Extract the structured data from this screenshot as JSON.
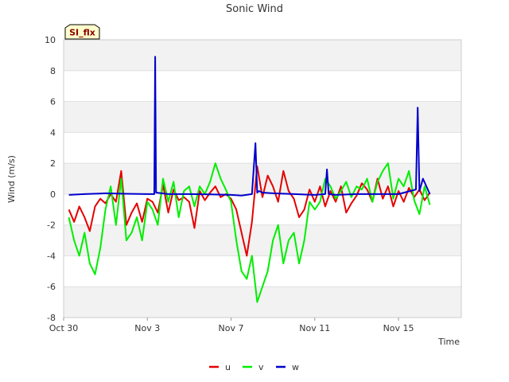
{
  "chart_data": {
    "type": "line",
    "title": "Sonic Wind",
    "xlabel": "Time",
    "ylabel": "Wind (m/s)",
    "badge": "SI_flx",
    "ylim": [
      -8,
      10
    ],
    "yticks": [
      -8,
      -6,
      -4,
      -2,
      0,
      2,
      4,
      6,
      8,
      10
    ],
    "xlim": [
      "2023-10-30",
      "2023-11-18"
    ],
    "xticks": [
      {
        "date": "2023-10-30",
        "label": "Oct 30"
      },
      {
        "date": "2023-11-03",
        "label": "Nov 3"
      },
      {
        "date": "2023-11-07",
        "label": "Nov 7"
      },
      {
        "date": "2023-11-11",
        "label": "Nov 11"
      },
      {
        "date": "2023-11-15",
        "label": "Nov 15"
      }
    ],
    "grid": true,
    "legend": "bottom",
    "series": [
      {
        "name": "u",
        "color": "#e60000",
        "x": [
          "2023-10-30 06:00",
          "2023-10-30 12:00",
          "2023-10-30 18:00",
          "2023-10-31 00:00",
          "2023-10-31 06:00",
          "2023-10-31 12:00",
          "2023-10-31 18:00",
          "2023-11-01 00:00",
          "2023-11-01 06:00",
          "2023-11-01 12:00",
          "2023-11-01 18:00",
          "2023-11-02 00:00",
          "2023-11-02 06:00",
          "2023-11-02 12:00",
          "2023-11-02 18:00",
          "2023-11-03 00:00",
          "2023-11-03 06:00",
          "2023-11-03 12:00",
          "2023-11-03 18:00",
          "2023-11-04 00:00",
          "2023-11-04 06:00",
          "2023-11-04 12:00",
          "2023-11-04 18:00",
          "2023-11-05 00:00",
          "2023-11-05 06:00",
          "2023-11-05 12:00",
          "2023-11-05 18:00",
          "2023-11-06 00:00",
          "2023-11-06 06:00",
          "2023-11-06 12:00",
          "2023-11-06 18:00",
          "2023-11-07 00:00",
          "2023-11-07 06:00",
          "2023-11-07 12:00",
          "2023-11-07 18:00",
          "2023-11-08 00:00",
          "2023-11-08 06:00",
          "2023-11-08 12:00",
          "2023-11-08 18:00",
          "2023-11-09 00:00",
          "2023-11-09 06:00",
          "2023-11-09 12:00",
          "2023-11-09 18:00",
          "2023-11-10 00:00",
          "2023-11-10 06:00",
          "2023-11-10 12:00",
          "2023-11-10 18:00",
          "2023-11-11 00:00",
          "2023-11-11 06:00",
          "2023-11-11 12:00",
          "2023-11-11 18:00",
          "2023-11-12 00:00",
          "2023-11-12 06:00",
          "2023-11-12 12:00",
          "2023-11-12 18:00",
          "2023-11-13 00:00",
          "2023-11-13 06:00",
          "2023-11-13 12:00",
          "2023-11-13 18:00",
          "2023-11-14 00:00",
          "2023-11-14 06:00",
          "2023-11-14 12:00",
          "2023-11-14 18:00",
          "2023-11-15 00:00",
          "2023-11-15 06:00",
          "2023-11-15 12:00",
          "2023-11-15 18:00",
          "2023-11-16 00:00",
          "2023-11-16 06:00",
          "2023-11-16 12:00"
        ],
        "y": [
          -1.0,
          -1.8,
          -0.8,
          -1.5,
          -2.4,
          -0.8,
          -0.3,
          -0.6,
          0.0,
          -0.5,
          1.5,
          -2.0,
          -1.2,
          -0.6,
          -1.8,
          -0.3,
          -0.5,
          -1.2,
          0.6,
          -1.2,
          0.3,
          -0.4,
          -0.2,
          -0.5,
          -2.2,
          0.2,
          -0.4,
          0.1,
          0.5,
          -0.2,
          0.0,
          -0.3,
          -1.0,
          -2.5,
          -4.0,
          -1.8,
          1.8,
          -0.2,
          1.2,
          0.5,
          -0.5,
          1.5,
          0.2,
          -0.3,
          -1.5,
          -1.0,
          0.3,
          -0.5,
          0.5,
          -0.8,
          0.2,
          -0.5,
          0.5,
          -1.2,
          -0.6,
          -0.1,
          0.7,
          0.3,
          -0.5,
          1.0,
          -0.3,
          0.5,
          -0.8,
          0.2,
          -0.5,
          0.4,
          -0.2,
          0.3,
          -0.4,
          0.1
        ]
      },
      {
        "name": "v",
        "color": "#00ee00",
        "x": [
          "2023-10-30 06:00",
          "2023-10-30 12:00",
          "2023-10-30 18:00",
          "2023-10-31 00:00",
          "2023-10-31 06:00",
          "2023-10-31 12:00",
          "2023-10-31 18:00",
          "2023-11-01 00:00",
          "2023-11-01 06:00",
          "2023-11-01 12:00",
          "2023-11-01 18:00",
          "2023-11-02 00:00",
          "2023-11-02 06:00",
          "2023-11-02 12:00",
          "2023-11-02 18:00",
          "2023-11-03 00:00",
          "2023-11-03 06:00",
          "2023-11-03 12:00",
          "2023-11-03 18:00",
          "2023-11-04 00:00",
          "2023-11-04 06:00",
          "2023-11-04 12:00",
          "2023-11-04 18:00",
          "2023-11-05 00:00",
          "2023-11-05 06:00",
          "2023-11-05 12:00",
          "2023-11-05 18:00",
          "2023-11-06 00:00",
          "2023-11-06 06:00",
          "2023-11-06 12:00",
          "2023-11-06 18:00",
          "2023-11-07 00:00",
          "2023-11-07 06:00",
          "2023-11-07 12:00",
          "2023-11-07 18:00",
          "2023-11-08 00:00",
          "2023-11-08 06:00",
          "2023-11-08 12:00",
          "2023-11-08 18:00",
          "2023-11-09 00:00",
          "2023-11-09 06:00",
          "2023-11-09 12:00",
          "2023-11-09 18:00",
          "2023-11-10 00:00",
          "2023-11-10 06:00",
          "2023-11-10 12:00",
          "2023-11-10 18:00",
          "2023-11-11 00:00",
          "2023-11-11 06:00",
          "2023-11-11 12:00",
          "2023-11-11 18:00",
          "2023-11-12 00:00",
          "2023-11-12 06:00",
          "2023-11-12 12:00",
          "2023-11-12 18:00",
          "2023-11-13 00:00",
          "2023-11-13 06:00",
          "2023-11-13 12:00",
          "2023-11-13 18:00",
          "2023-11-14 00:00",
          "2023-11-14 06:00",
          "2023-11-14 12:00",
          "2023-11-14 18:00",
          "2023-11-15 00:00",
          "2023-11-15 06:00",
          "2023-11-15 12:00",
          "2023-11-15 18:00",
          "2023-11-16 00:00",
          "2023-11-16 06:00",
          "2023-11-16 12:00"
        ],
        "y": [
          -1.5,
          -3.0,
          -4.0,
          -2.5,
          -4.5,
          -5.2,
          -3.5,
          -1.0,
          0.5,
          -2.0,
          1.0,
          -3.0,
          -2.5,
          -1.5,
          -3.0,
          -0.5,
          -1.0,
          -2.0,
          1.0,
          -0.5,
          0.8,
          -1.5,
          0.2,
          0.5,
          -0.8,
          0.5,
          0.0,
          0.8,
          2.0,
          1.0,
          0.3,
          -0.5,
          -3.0,
          -5.0,
          -5.5,
          -4.0,
          -7.0,
          -6.0,
          -5.0,
          -3.0,
          -2.0,
          -4.5,
          -3.0,
          -2.5,
          -4.5,
          -3.0,
          -0.5,
          -1.0,
          -0.5,
          1.0,
          0.5,
          -0.3,
          0.2,
          0.8,
          -0.2,
          0.5,
          0.3,
          1.0,
          -0.5,
          0.8,
          1.5,
          2.0,
          -0.3,
          1.0,
          0.5,
          1.5,
          -0.4,
          -1.3,
          0.5,
          -0.7
        ]
      },
      {
        "name": "w",
        "color": "#0000cc",
        "x": [
          "2023-10-30 06:00",
          "2023-10-31 00:00",
          "2023-11-01 00:00",
          "2023-11-02 00:00",
          "2023-11-03 00:00",
          "2023-11-03 08:00",
          "2023-11-03 09:00",
          "2023-11-03 10:00",
          "2023-11-04 00:00",
          "2023-11-05 00:00",
          "2023-11-06 00:00",
          "2023-11-07 00:00",
          "2023-11-07 12:00",
          "2023-11-08 00:00",
          "2023-11-08 04:00",
          "2023-11-08 06:00",
          "2023-11-08 08:00",
          "2023-11-08 12:00",
          "2023-11-09 00:00",
          "2023-11-10 00:00",
          "2023-11-11 00:00",
          "2023-11-11 12:00",
          "2023-11-11 14:00",
          "2023-11-11 16:00",
          "2023-11-12 00:00",
          "2023-11-13 00:00",
          "2023-11-14 00:00",
          "2023-11-15 00:00",
          "2023-11-15 20:00",
          "2023-11-15 22:00",
          "2023-11-16 00:00",
          "2023-11-16 04:00",
          "2023-11-16 12:00"
        ],
        "y": [
          -0.05,
          0.0,
          0.05,
          0.02,
          0.0,
          0.0,
          8.9,
          0.1,
          0.0,
          0.0,
          -0.02,
          -0.05,
          -0.1,
          0.0,
          3.3,
          0.1,
          0.2,
          0.1,
          0.05,
          0.0,
          -0.05,
          0.0,
          1.6,
          0.0,
          -0.05,
          0.0,
          0.0,
          0.0,
          0.3,
          5.6,
          0.2,
          1.0,
          0.0
        ]
      }
    ]
  }
}
